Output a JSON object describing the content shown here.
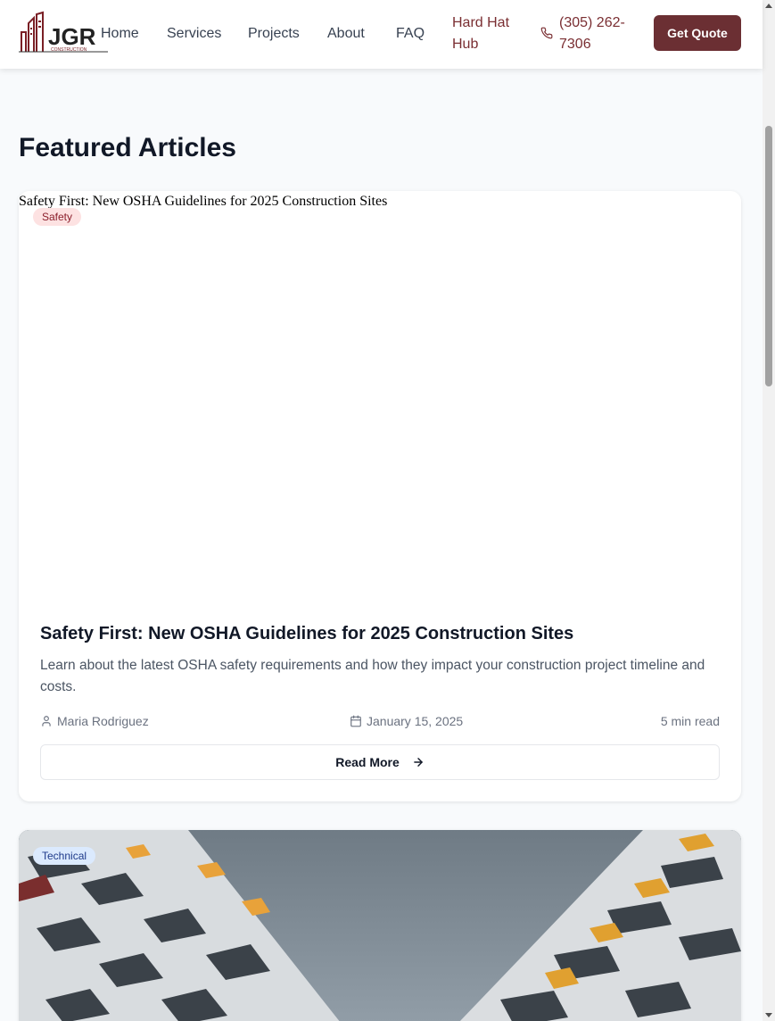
{
  "header": {
    "logo_text": "JGR",
    "logo_subtext": "CONSTRUCTION",
    "nav": [
      {
        "label": "Home"
      },
      {
        "label": "Services"
      },
      {
        "label": "Projects"
      },
      {
        "label": "About"
      },
      {
        "label": "FAQ"
      }
    ],
    "hub_label": "Hard Hat Hub",
    "phone": "(305) 262-7306",
    "cta_label": "Get Quote"
  },
  "main": {
    "section_title": "Featured Articles",
    "articles": [
      {
        "image_alt": "Safety First: New OSHA Guidelines for 2025 Construction Sites",
        "category": "Safety",
        "title": "Safety First: New OSHA Guidelines for 2025 Construction Sites",
        "excerpt": "Learn about the latest OSHA safety requirements and how they impact your construction project timeline and costs.",
        "author": "Maria Rodriguez",
        "date": "January 15, 2025",
        "read_time": "5 min read",
        "cta": "Read More"
      },
      {
        "category": "Technical"
      }
    ]
  },
  "colors": {
    "brand": "#6b2f33",
    "brand_text": "#7a2e32",
    "background": "#f8fafc",
    "safety_badge_bg": "#fde2e2",
    "technical_badge_bg": "#dbeafe"
  },
  "icons": [
    "phone-icon",
    "user-icon",
    "calendar-icon",
    "arrow-right-icon"
  ]
}
